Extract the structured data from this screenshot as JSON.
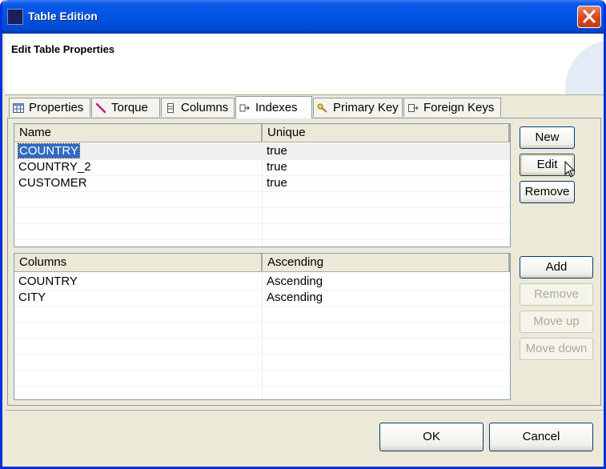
{
  "window": {
    "title": "Table Edition"
  },
  "banner": {
    "title": "Edit Table Properties"
  },
  "tabs": [
    {
      "label": "Properties",
      "icon": "table-icon"
    },
    {
      "label": "Torque",
      "icon": "wand-icon"
    },
    {
      "label": "Columns",
      "icon": "columns-icon"
    },
    {
      "label": "Indexes",
      "icon": "index-icon",
      "active": true
    },
    {
      "label": "Primary Key",
      "icon": "key-icon"
    },
    {
      "label": "Foreign Keys",
      "icon": "foreign-key-icon"
    }
  ],
  "indexes_table": {
    "headers": [
      "Name",
      "Unique"
    ],
    "rows": [
      [
        "COUNTRY",
        "true"
      ],
      [
        "COUNTRY_2",
        "true"
      ],
      [
        "CUSTOMER",
        "true"
      ]
    ]
  },
  "columns_table": {
    "headers": [
      "Columns",
      "Ascending"
    ],
    "rows": [
      [
        "COUNTRY",
        "Ascending"
      ],
      [
        "CITY",
        "Ascending"
      ]
    ]
  },
  "index_buttons": {
    "new": "New",
    "edit": "Edit",
    "remove": "Remove"
  },
  "column_buttons": {
    "add": "Add",
    "remove": "Remove",
    "move_up": "Move up",
    "move_down": "Move down"
  },
  "footer": {
    "ok": "OK",
    "cancel": "Cancel"
  },
  "colors": {
    "titlebar": "#0054e3",
    "selection": "#316ac5",
    "dialog_bg": "#ece9d8"
  }
}
